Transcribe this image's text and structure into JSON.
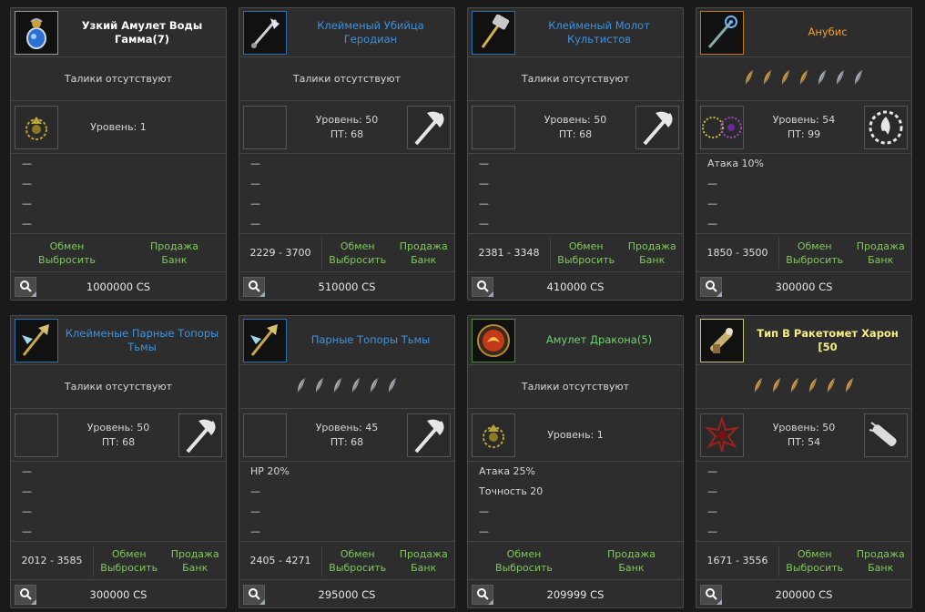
{
  "cards": [
    {
      "name": "Узкий Амулет Воды Гамма(7)",
      "quality": "white",
      "item_icon": "amulet-icon",
      "talismans": "Талики отсутствуют",
      "feathers": 0,
      "level": "Уровень: 1",
      "pt": "",
      "left_slot": "rune-icon",
      "right_slot": "",
      "props": [
        "—",
        "—",
        "—",
        "—"
      ],
      "damage": "",
      "exchange": "Обмен",
      "drop": "Выбросить",
      "sell": "Продажа",
      "bank": "Банк",
      "price": "1000000 CS"
    },
    {
      "name": "Клейменый Убийца Геродиан",
      "quality": "blue",
      "item_icon": "axe-weapon-icon",
      "talismans": "Талики отсутствуют",
      "feathers": 0,
      "level": "Уровень: 50",
      "pt": "ПТ: 68",
      "left_slot": "",
      "right_slot": "battle-axe-icon",
      "props": [
        "—",
        "—",
        "—",
        "—"
      ],
      "damage": "2229 - 3700",
      "exchange": "Обмен",
      "drop": "Выбросить",
      "sell": "Продажа",
      "bank": "Банк",
      "price": "510000 CS"
    },
    {
      "name": "Клейменый Молот Культистов",
      "quality": "blue",
      "item_icon": "hammer-weapon-icon",
      "talismans": "Талики отсутствуют",
      "feathers": 0,
      "level": "Уровень: 50",
      "pt": "ПТ: 68",
      "left_slot": "",
      "right_slot": "battle-axe-icon",
      "props": [
        "—",
        "—",
        "—",
        "—"
      ],
      "damage": "2381 - 3348",
      "exchange": "Обмен",
      "drop": "Выбросить",
      "sell": "Продажа",
      "bank": "Банк",
      "price": "410000 CS"
    },
    {
      "name": "Анубис",
      "quality": "orange",
      "item_icon": "staff-weapon-icon",
      "talismans": "",
      "feathers": 7,
      "feather_colors": [
        "#e8a43a",
        "#e8a43a",
        "#e8a43a",
        "#e8a43a",
        "#b6bec8",
        "#b6bec8",
        "#b6bec8"
      ],
      "level": "Уровень: 54",
      "pt": "ПТ: 99",
      "left_slot": "rune-pair-icon",
      "right_slot": "fire-saw-icon",
      "props": [
        "Атака 10%",
        "—",
        "—",
        "—"
      ],
      "damage": "1850 - 3500",
      "exchange": "Обмен",
      "drop": "Выбросить",
      "sell": "Продажа",
      "bank": "Банк",
      "price": "300000 CS"
    },
    {
      "name": "Клейменые Парные Топоры Тьмы",
      "quality": "blue",
      "item_icon": "dual-axe-icon",
      "talismans": "Талики отсутствуют",
      "feathers": 0,
      "level": "Уровень: 50",
      "pt": "ПТ: 68",
      "left_slot": "",
      "right_slot": "battle-axe-icon",
      "props": [
        "—",
        "—",
        "—",
        "—"
      ],
      "damage": "2012 - 3585",
      "exchange": "Обмен",
      "drop": "Выбросить",
      "sell": "Продажа",
      "bank": "Банк",
      "price": "300000 CS"
    },
    {
      "name": "Парные Топоры Тьмы",
      "quality": "blue",
      "item_icon": "dual-axe-icon",
      "talismans": "",
      "feathers": 6,
      "feather_colors": [
        "#b6bec8",
        "#b6bec8",
        "#b6bec8",
        "#b6bec8",
        "#b6bec8",
        "#b6bec8"
      ],
      "level": "Уровень: 45",
      "pt": "ПТ: 68",
      "left_slot": "",
      "right_slot": "battle-axe-icon",
      "props": [
        "HP 20%",
        "—",
        "—",
        "—"
      ],
      "damage": "2405 - 4271",
      "exchange": "Обмен",
      "drop": "Выбросить",
      "sell": "Продажа",
      "bank": "Банк",
      "price": "295000 CS"
    },
    {
      "name": "Амулет Дракона(5)",
      "quality": "green",
      "item_icon": "dragon-amulet-icon",
      "talismans": "Талики отсутствуют",
      "feathers": 0,
      "level": "Уровень: 1",
      "pt": "",
      "left_slot": "rune-icon",
      "right_slot": "",
      "props": [
        "Атака 25%",
        "Точность 20",
        "—",
        "—"
      ],
      "damage": "",
      "exchange": "Обмен",
      "drop": "Выбросить",
      "sell": "Продажа",
      "bank": "Банк",
      "price": "209999 CS"
    },
    {
      "name": "Тип В Ракетомет Харон [50",
      "quality": "yellow",
      "item_icon": "rocket-launcher-icon",
      "talismans": "",
      "feathers": 6,
      "feather_colors": [
        "#e8a43a",
        "#e8a43a",
        "#e8a43a",
        "#e8a43a",
        "#e8a43a",
        "#e8a43a"
      ],
      "level": "Уровень: 50",
      "pt": "ПТ: 54",
      "left_slot": "red-rune-icon",
      "right_slot": "launcher-class-icon",
      "props": [
        "—",
        "—",
        "—",
        "—"
      ],
      "damage": "1671 - 3556",
      "exchange": "Обмен",
      "drop": "Выбросить",
      "sell": "Продажа",
      "bank": "Банк",
      "price": "200000 CS"
    }
  ],
  "colors": {
    "white": "#ffffff",
    "blue": "#3d93e0",
    "orange": "#f0a030",
    "green": "#6ed46e",
    "yellow": "#f3ef86",
    "action": "#7fc95a"
  }
}
